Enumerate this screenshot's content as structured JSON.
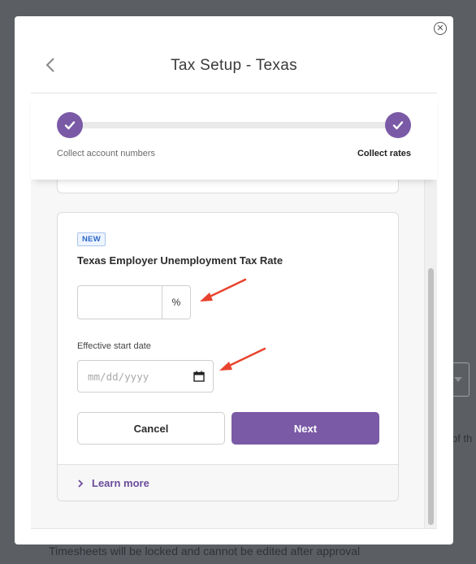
{
  "background": {
    "right_text": "of th",
    "footer_text": "Timesheets will be locked and cannot be edited after approval"
  },
  "modal": {
    "title": "Tax Setup - Texas",
    "close_icon": "close-circle-icon",
    "back_icon": "chevron-left-icon"
  },
  "stepper": {
    "steps": [
      {
        "label": "Collect account numbers",
        "completed": true
      },
      {
        "label": "Collect rates",
        "completed": true,
        "active": true
      }
    ],
    "accent_color": "#7a5aa6"
  },
  "card": {
    "badge": "NEW",
    "title": "Texas Employer Unemployment Tax Rate",
    "rate": {
      "value": "",
      "suffix": "%"
    },
    "date": {
      "label": "Effective start date",
      "placeholder": "mm/dd/yyyy",
      "icon": "calendar-icon"
    },
    "cancel_label": "Cancel",
    "next_label": "Next",
    "learn_more": "Learn more"
  },
  "annotations": {
    "arrow_color": "#e8432d"
  }
}
